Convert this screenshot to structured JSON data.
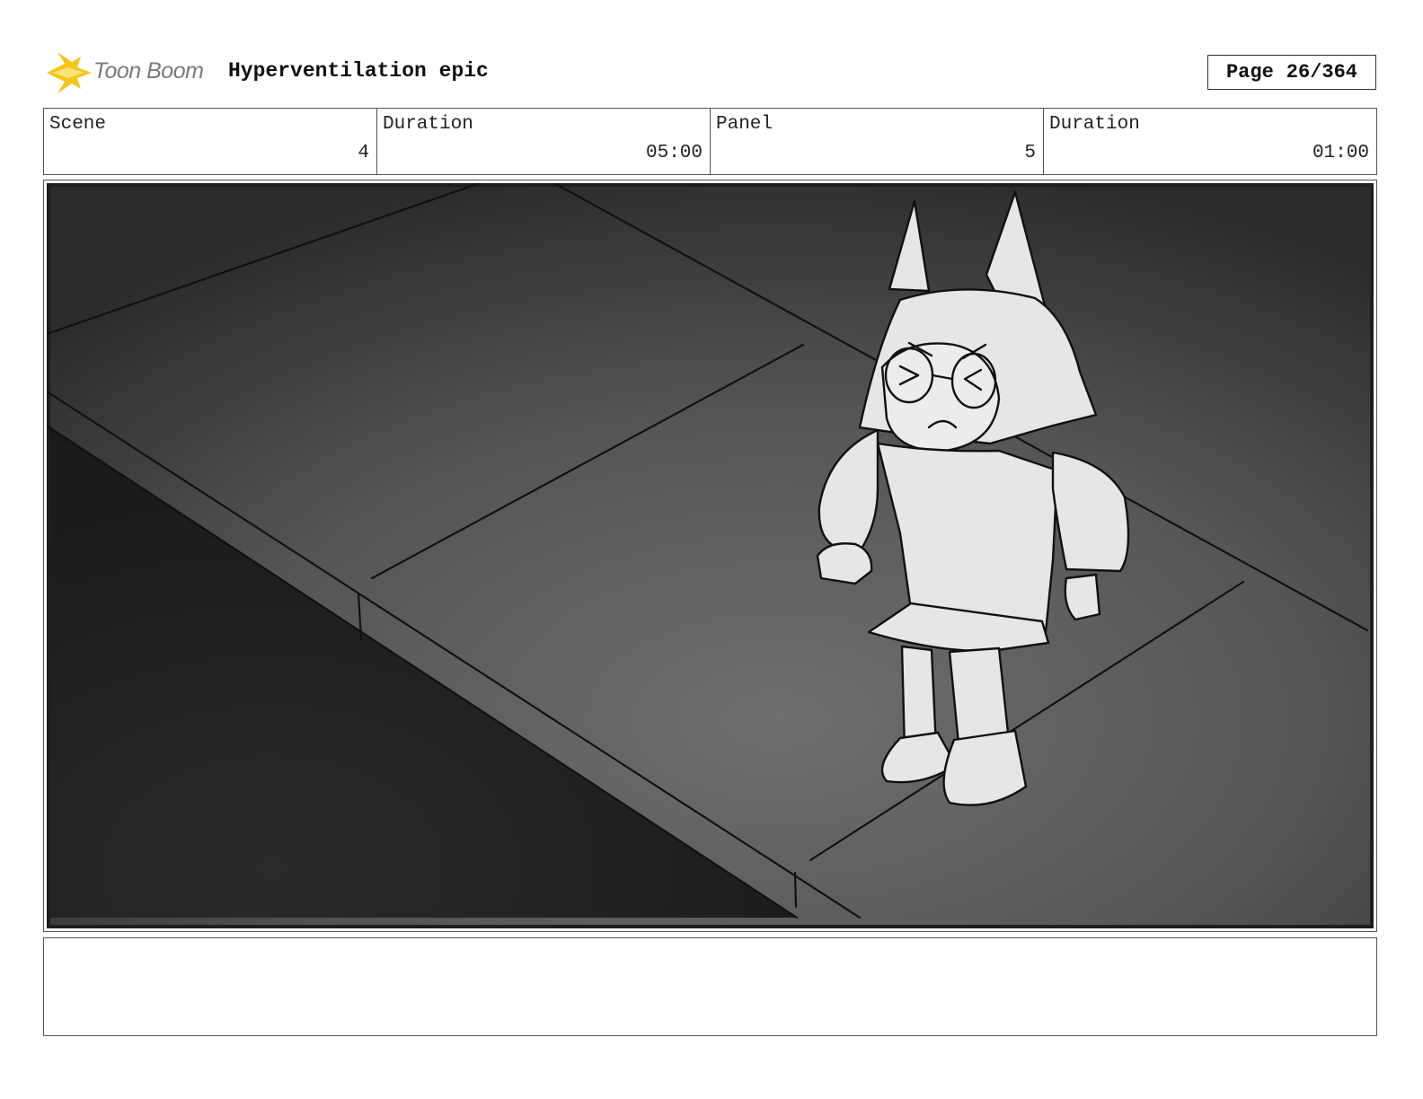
{
  "header": {
    "brand": "Toon Boom",
    "project_title": "Hyperventilation epic",
    "page_label": "Page",
    "page_value": "26/364"
  },
  "info": {
    "scene_label": "Scene",
    "scene_value": "4",
    "scene_duration_label": "Duration",
    "scene_duration_value": "05:00",
    "panel_label": "Panel",
    "panel_value": "5",
    "panel_duration_label": "Duration",
    "panel_duration_value": "01:00"
  },
  "notes": {
    "text": ""
  },
  "icons": {
    "brand_logo": "toon-boom-star-icon"
  },
  "colors": {
    "logo_star": "#f5c518",
    "background_dark": "#222222",
    "floor": "#5a5a5a",
    "character_fill": "#e6e6e6",
    "ink": "#111111"
  }
}
